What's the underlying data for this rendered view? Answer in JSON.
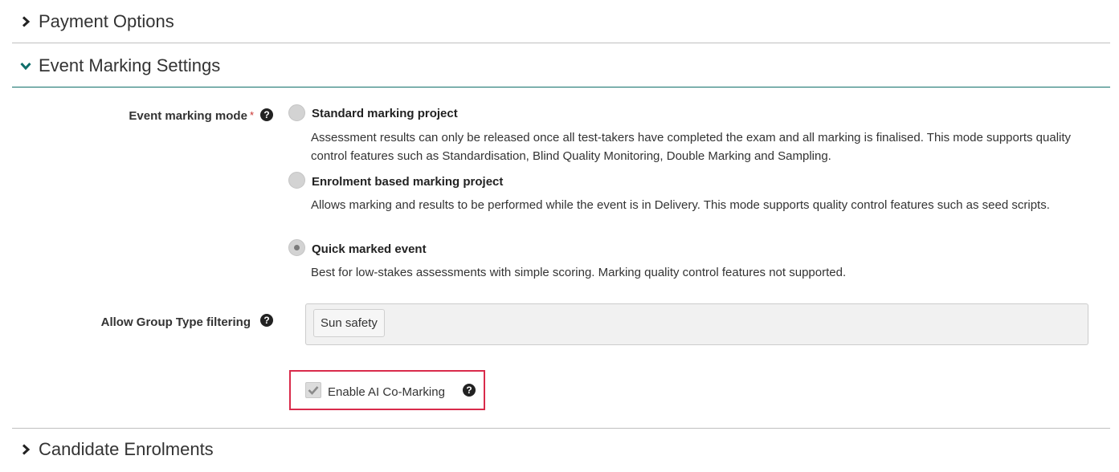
{
  "sections": {
    "payment": {
      "title": "Payment Options",
      "expanded": false
    },
    "marking": {
      "title": "Event Marking Settings",
      "expanded": true
    },
    "candidate": {
      "title": "Candidate Enrolments",
      "expanded": false
    }
  },
  "marking_mode": {
    "label": "Event marking mode",
    "required_mark": "*",
    "help_icon": "question-circle-icon",
    "options": [
      {
        "title": "Standard marking project",
        "description": "Assessment results can only be released once all test-takers have completed the exam and all marking is finalised. This mode supports quality control features such as Standardisation, Blind Quality Monitoring, Double Marking and Sampling.",
        "selected": false
      },
      {
        "title": "Enrolment based marking project",
        "description": "Allows marking and results to be performed while the event is in Delivery. This mode supports quality control features such as seed scripts.",
        "selected": false
      },
      {
        "title": "Quick marked event",
        "description": "Best for low-stakes assessments with simple scoring. Marking quality control features not supported.",
        "selected": true
      }
    ]
  },
  "group_filter": {
    "label": "Allow Group Type filtering",
    "tags": [
      "Sun safety"
    ]
  },
  "ai_comarking": {
    "label": "Enable AI Co-Marking",
    "checked": true
  },
  "colors": {
    "accent_teal": "#0f6e6a",
    "highlight_border": "#d92b4b"
  }
}
